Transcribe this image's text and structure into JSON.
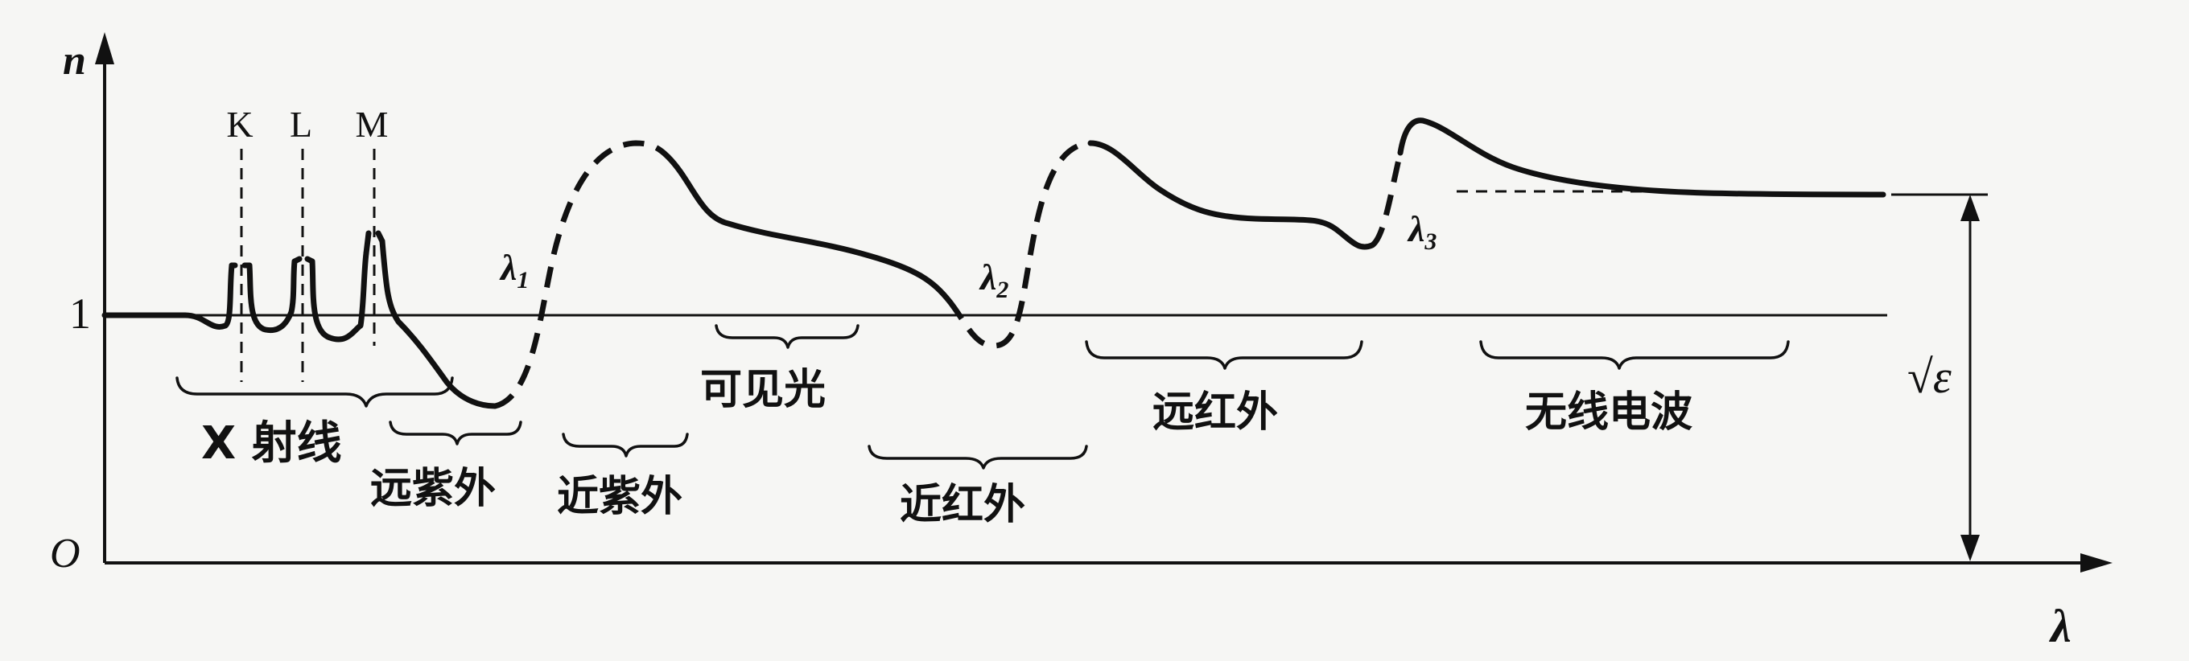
{
  "axes": {
    "y_label": "n",
    "x_label": "λ",
    "origin_label": "O",
    "unit_tick_label": "1",
    "eps_label": "√ε"
  },
  "xray_edges": [
    "K",
    "L",
    "M"
  ],
  "wavelengths": {
    "l1": "λ",
    "l1_sub": "1",
    "l2": "λ",
    "l2_sub": "2",
    "l3": "λ",
    "l3_sub": "3"
  },
  "regions": {
    "xray": "X 射线",
    "far_uv": "远紫外",
    "near_uv": "近紫外",
    "visible": "可见光",
    "near_ir": "近红外",
    "far_ir": "远红外",
    "radio": "无线电波"
  }
}
